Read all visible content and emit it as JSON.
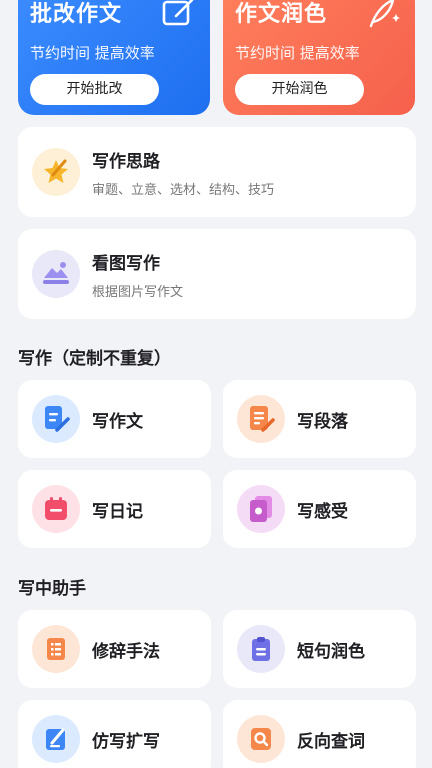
{
  "promo": [
    {
      "title": "批改作文",
      "subtitle": "节约时间 提高效率",
      "button": "开始批改",
      "icon": "edit-square-icon"
    },
    {
      "title": "作文润色",
      "subtitle": "节约时间 提高效率",
      "button": "开始润色",
      "icon": "quill-sparkle-icon"
    }
  ],
  "features": [
    {
      "title": "写作思路",
      "subtitle": "审题、立意、选材、结构、技巧",
      "icon": "star-pen-icon"
    },
    {
      "title": "看图写作",
      "subtitle": "根据图片写作文",
      "icon": "picture-mountain-icon"
    }
  ],
  "section_custom": {
    "title": "写作（定制不重复）",
    "items": [
      {
        "label": "写作文",
        "icon": "document-pen-icon"
      },
      {
        "label": "写段落",
        "icon": "paragraph-pen-icon"
      },
      {
        "label": "写日记",
        "icon": "calendar-diary-icon"
      },
      {
        "label": "写感受",
        "icon": "flower-card-icon"
      }
    ]
  },
  "section_helper": {
    "title": "写中助手",
    "items": [
      {
        "label": "修辞手法",
        "icon": "list-doc-icon"
      },
      {
        "label": "短句润色",
        "icon": "clipboard-icon"
      },
      {
        "label": "仿写扩写",
        "icon": "pen-doc-icon"
      },
      {
        "label": "反向查词",
        "icon": "search-doc-icon"
      }
    ]
  },
  "colors": {
    "background": "#f2f3f7",
    "blue_card": "#1e6ff0",
    "red_card": "#f5604c"
  }
}
